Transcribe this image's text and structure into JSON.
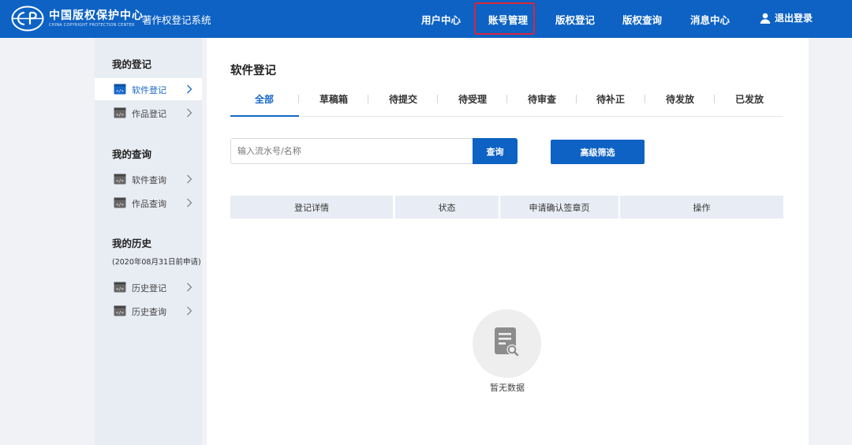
{
  "header": {
    "logo_title": "中国版权保护中心",
    "logo_subtitle": "CHINA COPYRIGHT PROTECTION CENTER",
    "system_name": "著作权登记系统",
    "nav": [
      {
        "label": "用户中心"
      },
      {
        "label": "账号管理"
      },
      {
        "label": "版权登记"
      },
      {
        "label": "版权查询"
      },
      {
        "label": "消息中心"
      }
    ],
    "highlighted_nav": "账号管理",
    "logout": "退出登录"
  },
  "sidebar": {
    "sections": [
      {
        "heading": "我的登记",
        "items": [
          {
            "label": "软件登记",
            "active": true
          },
          {
            "label": "作品登记"
          }
        ]
      },
      {
        "heading": "我的查询",
        "items": [
          {
            "label": "软件查询"
          },
          {
            "label": "作品查询"
          }
        ]
      },
      {
        "heading": "我的历史",
        "note": "(2020年08月31日前申请)",
        "items": [
          {
            "label": "历史登记"
          },
          {
            "label": "历史查询"
          }
        ]
      }
    ]
  },
  "main": {
    "title": "软件登记",
    "tabs": [
      {
        "label": "全部",
        "active": true
      },
      {
        "label": "草稿箱"
      },
      {
        "label": "待提交"
      },
      {
        "label": "待受理"
      },
      {
        "label": "待审查"
      },
      {
        "label": "待补正"
      },
      {
        "label": "待发放"
      },
      {
        "label": "已发放"
      }
    ],
    "search": {
      "placeholder": "输入流水号/名称",
      "value": "",
      "button": "查询"
    },
    "advanced_filter": "高级筛选",
    "table_headers": [
      "登记详情",
      "状态",
      "申请确认签章页",
      "操作"
    ],
    "empty_text": "暂无数据"
  },
  "colors": {
    "header_bg": "#0d62c4",
    "accent": "#1767c8",
    "highlight_border": "#d9263a",
    "sidebar_bg": "#e8ecf3",
    "page_bg": "#f0f2f5"
  },
  "icons": {
    "logo": "copyright-center-logo",
    "user": "user-icon",
    "side_item": "code-window-icon",
    "chevron": "chevron-right-icon",
    "empty": "document-search-icon"
  }
}
